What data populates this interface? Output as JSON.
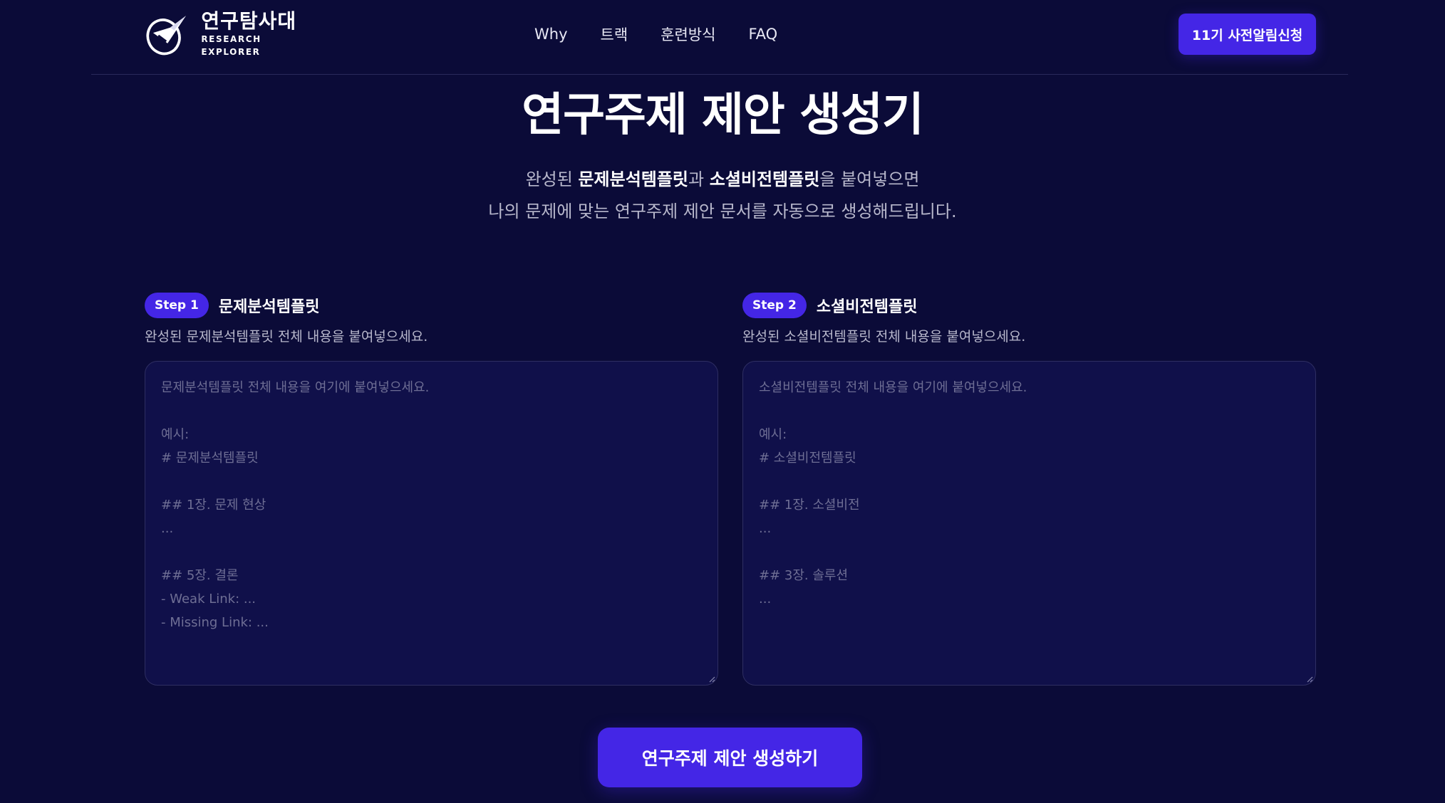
{
  "header": {
    "logo_title": "연구탐사대",
    "logo_subtitle": "RESEARCH EXPLORER",
    "nav": [
      {
        "label": "Why"
      },
      {
        "label": "트랙"
      },
      {
        "label": "훈련방식"
      },
      {
        "label": "FAQ"
      }
    ],
    "cta_label": "11기 사전알림신청"
  },
  "hero": {
    "title": "연구주제 제안 생성기",
    "desc_line1_pre": "완성된 ",
    "desc_line1_bold1": "문제분석템플릿",
    "desc_line1_mid": "과 ",
    "desc_line1_bold2": "소셜비전템플릿",
    "desc_line1_post": "을 붙여넣으면",
    "desc_line2": "나의 문제에 맞는 연구주제 제안 문서를 자동으로 생성해드립니다."
  },
  "step1": {
    "badge": "Step 1",
    "title": "문제분석템플릿",
    "desc": "완성된 문제분석템플릿 전체 내용을 붙여넣으세요.",
    "placeholder_lines": [
      "문제분석템플릿 전체 내용을 여기에 붙여넣으세요.",
      "",
      "예시:",
      "# 문제분석템플릿",
      "",
      "## 1장. 문제 현상",
      "...",
      "",
      "## 5장. 결론",
      "- Weak Link: ...",
      "- Missing Link: ..."
    ]
  },
  "step2": {
    "badge": "Step 2",
    "title": "소셜비전템플릿",
    "desc": "완성된 소셜비전템플릿 전체 내용을 붙여넣으세요.",
    "placeholder_lines": [
      "소셜비전템플릿 전체 내용을 여기에 붙여넣으세요.",
      "",
      "예시:",
      "# 소셜비전템플릿",
      "",
      "## 1장. 소셜비전",
      "...",
      "",
      "## 3장. 솔루션",
      "..."
    ]
  },
  "submit_label": "연구주제 제안 생성하기",
  "colors": {
    "background": "#0b0b38",
    "accent": "#4426e6",
    "textarea_bg": "#10104a"
  }
}
